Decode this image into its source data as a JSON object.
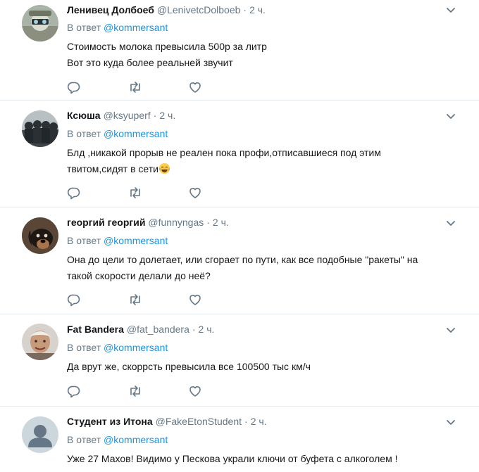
{
  "reply_prefix": "В ответ",
  "icons": {
    "reply": "reply-icon",
    "retweet": "retweet-icon",
    "like": "heart-icon",
    "more": "chevron-down-icon"
  },
  "colors": {
    "link": "#1b95e0",
    "secondary": "#657786",
    "text": "#14171a",
    "divider": "#e6ecf0"
  },
  "tweets": [
    {
      "name": "Ленивец Долбоеб",
      "handle": "@LenivetcDolboeb",
      "time": "2 ч.",
      "reply_to": "@kommersant",
      "lines": [
        "Стоимость молока превысила 500р за литр",
        "Вот это куда более реальней звучит"
      ]
    },
    {
      "name": "Ксюша",
      "handle": "@ksyuperf",
      "time": "2 ч.",
      "reply_to": "@kommersant",
      "lines": [
        "Блд ,никакой прорыв не реален пока профи,отписавшиеся под этим",
        "твитом,сидят в сети"
      ],
      "emoji": "face-with-tears-of-joy-icon"
    },
    {
      "name": "георгий георгий",
      "handle": "@funnyngas",
      "time": "2 ч.",
      "reply_to": "@kommersant",
      "lines": [
        "Она до цели то долетает, или сгорает по пути, как все подобные \"ракеты\" на",
        "такой скорости делали до неё?"
      ]
    },
    {
      "name": "Fat Bandera",
      "handle": "@fat_bandera",
      "time": "2 ч.",
      "reply_to": "@kommersant",
      "lines": [
        "Да врут же, скоррсть превысила все 100500 тыс км/ч"
      ]
    },
    {
      "name": "Студент из Итона",
      "handle": "@FakeEtonStudent",
      "time": "2 ч.",
      "reply_to": "@kommersant",
      "lines": [
        "Уже 27 Махов! Видимо у Пескова украли ключи от буфета с алкоголем !"
      ]
    }
  ]
}
